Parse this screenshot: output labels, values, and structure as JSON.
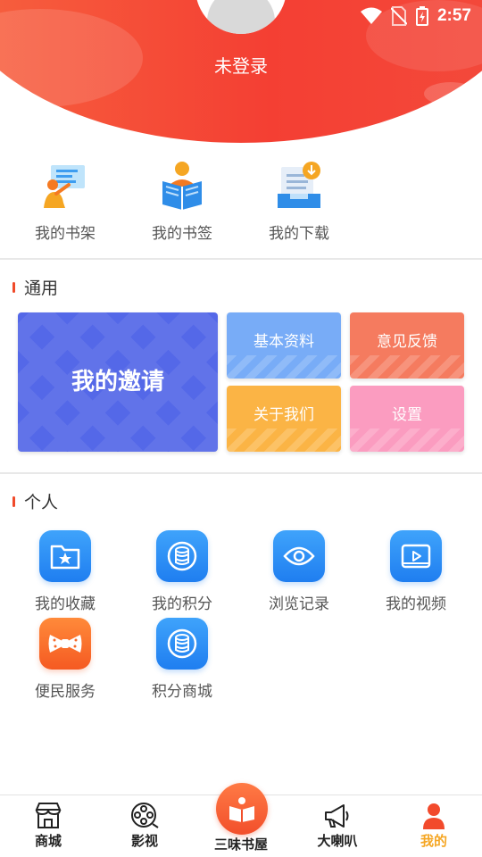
{
  "status_bar": {
    "time": "2:57"
  },
  "profile": {
    "login_text": "未登录"
  },
  "shortcuts": [
    {
      "label": "我的书架",
      "icon": "bookshelf-icon"
    },
    {
      "label": "我的书签",
      "icon": "bookmark-icon"
    },
    {
      "label": "我的下载",
      "icon": "download-icon"
    }
  ],
  "general": {
    "title": "通用",
    "invite": "我的邀请",
    "basic_info": "基本资料",
    "feedback": "意见反馈",
    "about_us": "关于我们",
    "settings": "设置"
  },
  "personal": {
    "title": "个人",
    "items": [
      {
        "label": "我的收藏",
        "icon": "favorites-folder-icon"
      },
      {
        "label": "我的积分",
        "icon": "points-coins-icon"
      },
      {
        "label": "浏览记录",
        "icon": "eye-icon"
      },
      {
        "label": "我的视频",
        "icon": "video-play-icon"
      },
      {
        "label": "便民服务",
        "icon": "bow-tie-icon"
      },
      {
        "label": "积分商城",
        "icon": "coins-mall-icon"
      }
    ]
  },
  "bottom_nav": {
    "store": "商城",
    "video": "影视",
    "bookstore": "三味书屋",
    "speaker": "大喇叭",
    "mine": "我的"
  },
  "colors": {
    "accent": "#f24a2c",
    "invite_tile": "#5468e8",
    "blue_icon": "#2a8cf5"
  }
}
